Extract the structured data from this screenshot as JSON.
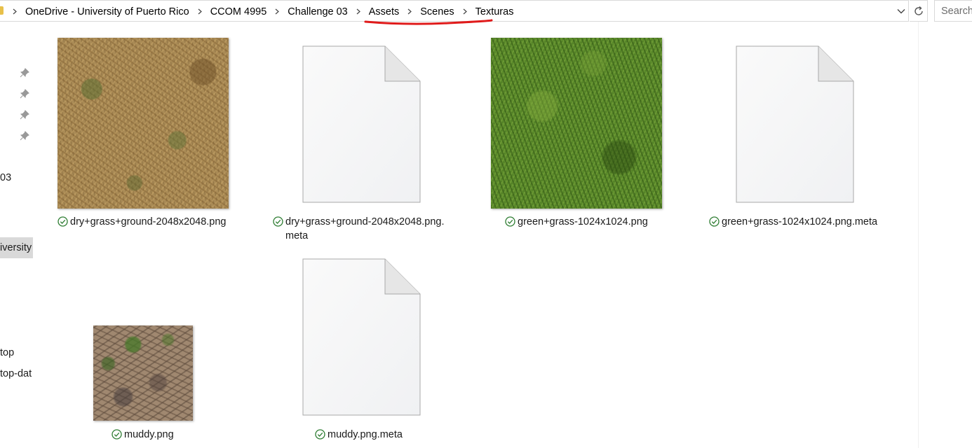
{
  "address_bar": {
    "breadcrumbs": [
      "OneDrive - University of Puerto Rico",
      "CCOM 4995",
      "Challenge 03",
      "Assets",
      "Scenes",
      "Texturas"
    ]
  },
  "search": {
    "placeholder": "Search"
  },
  "nav": {
    "items": [
      {
        "label": "03"
      },
      {
        "label": "iversity"
      },
      {
        "label": "top"
      },
      {
        "label": "top-dat"
      }
    ]
  },
  "files": [
    {
      "name": "dry+grass+ground-2048x2048.png",
      "status": "synced",
      "kind": "image"
    },
    {
      "name": "dry+grass+ground-2048x2048.png.\nmeta",
      "status": "synced",
      "kind": "document"
    },
    {
      "name": "green+grass-1024x1024.png",
      "status": "synced",
      "kind": "image"
    },
    {
      "name": "green+grass-1024x1024.png.meta",
      "status": "synced",
      "kind": "document"
    },
    {
      "name": "muddy.png",
      "status": "synced",
      "kind": "image"
    },
    {
      "name": "muddy.png.meta",
      "status": "synced",
      "kind": "document"
    }
  ],
  "colors": {
    "sync_check": "#2e7d32",
    "annotation_underline": "#e01b1b",
    "selection": "#d9d9d9"
  },
  "icons": {
    "pin": "pin-icon",
    "chevron": "chevron-right-icon",
    "dropdown": "chevron-down-icon",
    "refresh": "refresh-icon",
    "sync": "sync-check-icon",
    "doc": "document-icon"
  }
}
